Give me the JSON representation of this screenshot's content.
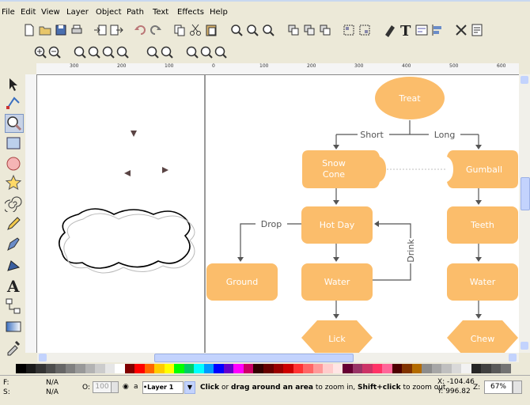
{
  "menu": [
    "File",
    "Edit",
    "View",
    "Layer",
    "Object",
    "Path",
    "Text",
    "Effects",
    "Help"
  ],
  "ruler_ticks": [
    "300",
    "200",
    "100",
    "0",
    "100",
    "200",
    "300",
    "400",
    "500",
    "600"
  ],
  "flowchart": {
    "treat": "Treat",
    "short": "Short",
    "long": "Long",
    "snow_cone_l1": "Snow",
    "snow_cone_l2": "Cone",
    "gumball": "Gumball",
    "hot_day": "Hot Day",
    "teeth": "Teeth",
    "drop": "Drop",
    "drink": "Drink",
    "ground": "Ground",
    "water_left": "Water",
    "water_right": "Water",
    "lick": "Lick",
    "chew": "Chew"
  },
  "status": {
    "f_label": "F:",
    "s_label": "S:",
    "f_value": "N/A",
    "s_value": "N/A",
    "o_label": "O:",
    "opacity": "100",
    "layer": "•Layer 1",
    "msg_b1": "Click",
    "msg_t1": " or ",
    "msg_b2": "drag around an area",
    "msg_t2": " to zoom in, ",
    "msg_b3": "Shift+click",
    "msg_t3": " to zoom out",
    "x_coord": "X: -104.46",
    "y_coord": "Y: 996.82",
    "z_label": "Z:",
    "zoom": "67%"
  },
  "colors": {
    "node_fill": "#fbbd6b",
    "node_text": "#ffffff",
    "arrow": "#555555",
    "palette": [
      "#000000",
      "#1a1a1a",
      "#333333",
      "#4d4d4d",
      "#666666",
      "#808080",
      "#999999",
      "#b3b3b3",
      "#cccccc",
      "#e6e6e6",
      "#ffffff",
      "#800000",
      "#ff0000",
      "#ff6600",
      "#ffcc00",
      "#ffff00",
      "#00ff00",
      "#00cc66",
      "#00ffff",
      "#0099ff",
      "#0000ff",
      "#6600cc",
      "#ff00ff",
      "#cc0066",
      "#330000",
      "#660000",
      "#990000",
      "#cc0000",
      "#ff3333",
      "#ff6666",
      "#ff9999",
      "#ffcccc",
      "#ffe5e5",
      "#660033",
      "#993366",
      "#cc3366",
      "#ff3366",
      "#ff6699",
      "#4d0000",
      "#803300",
      "#b36b00",
      "#8c8c8c",
      "#a6a6a6",
      "#bfbfbf",
      "#d9d9d9",
      "#f2f2f2",
      "#262626",
      "#404040",
      "#595959",
      "#737373"
    ]
  }
}
